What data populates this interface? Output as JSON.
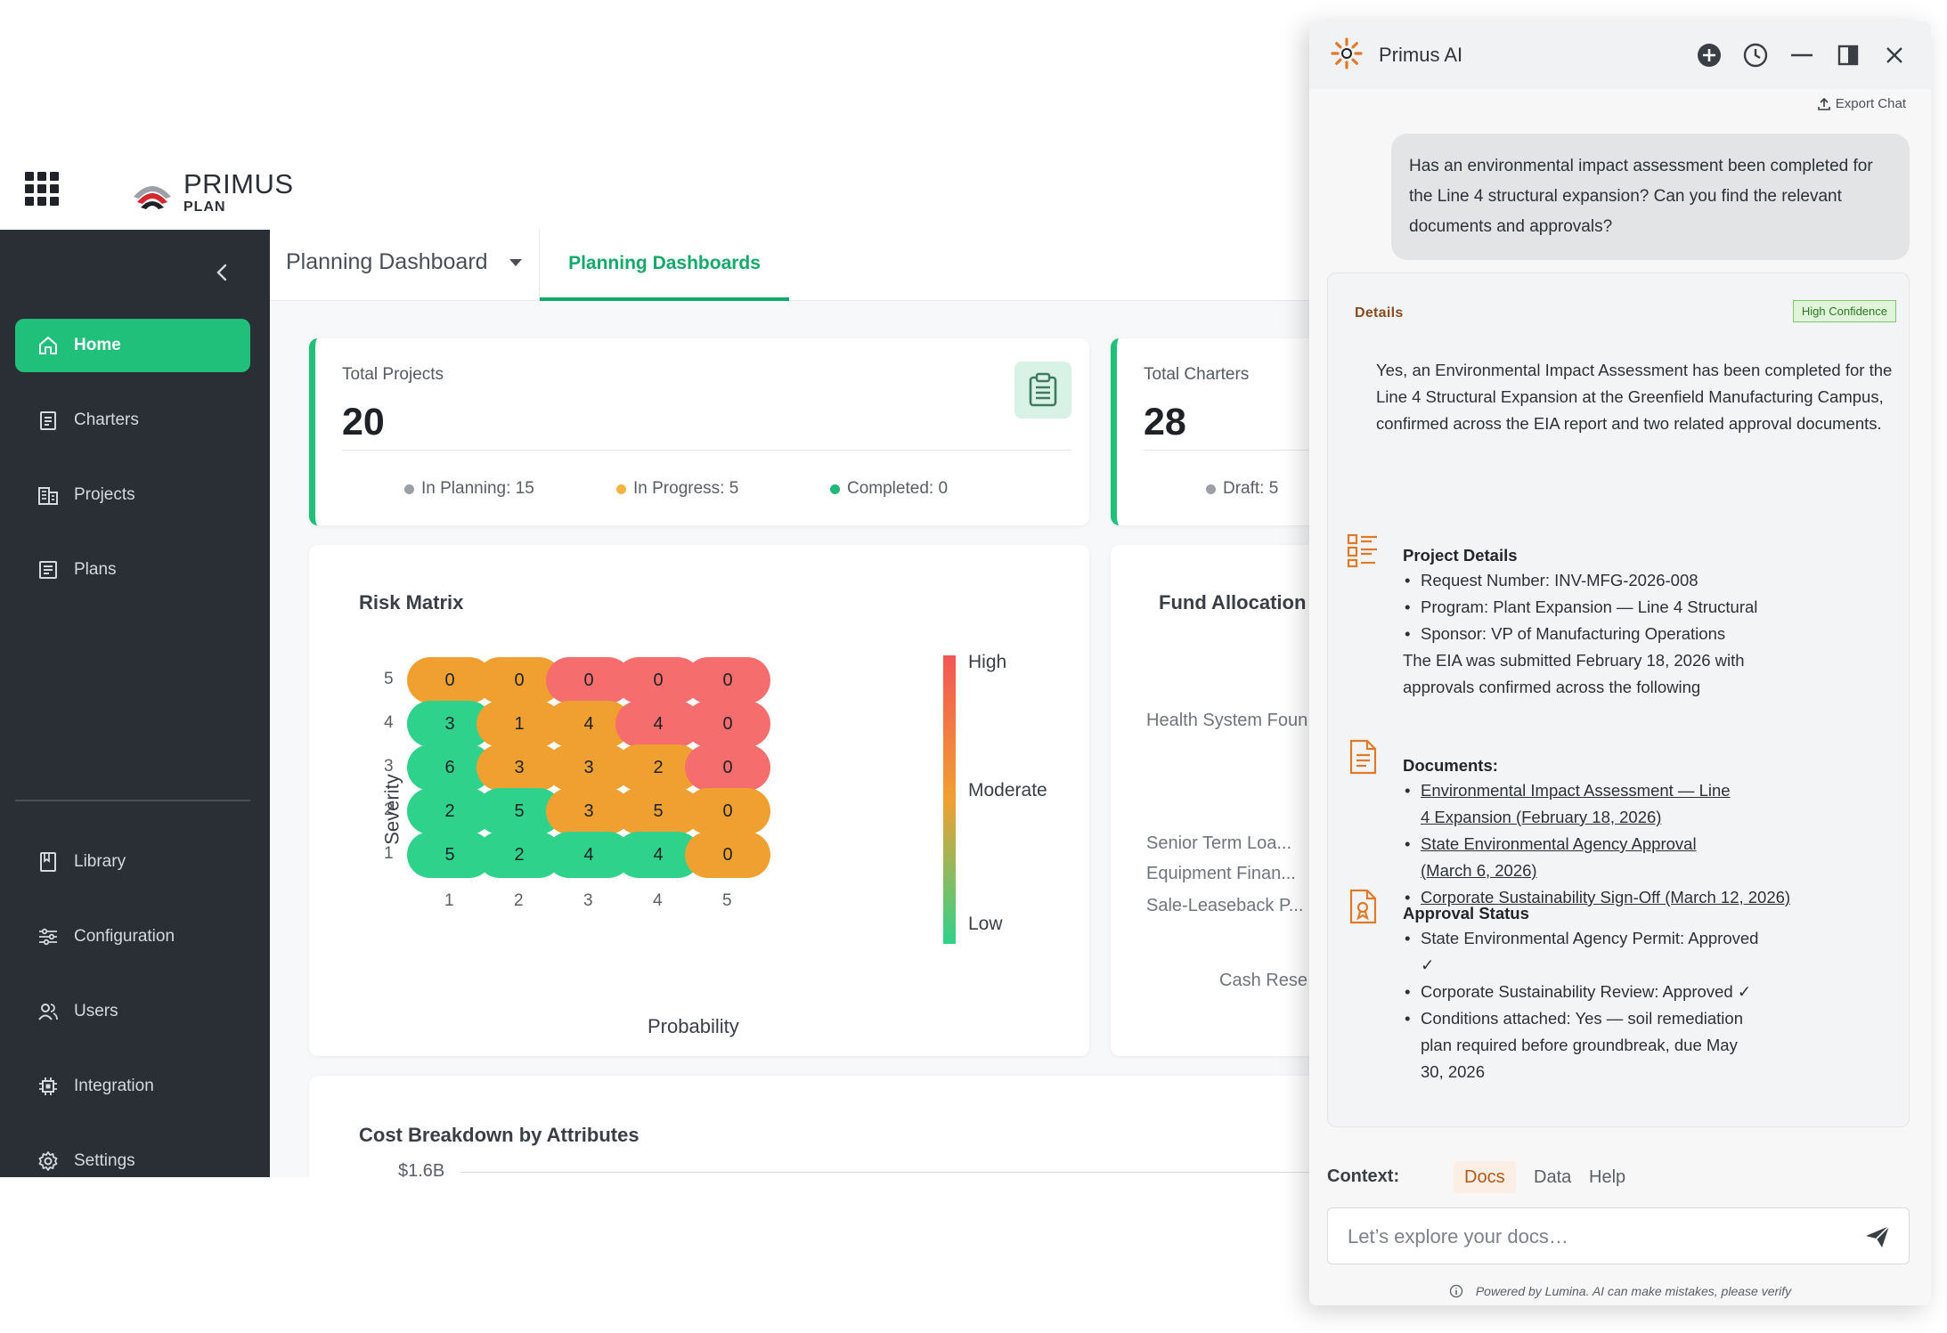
{
  "app": {
    "logo_main": "PRIMUS",
    "logo_sub": "PLAN"
  },
  "sidebar": {
    "items": [
      {
        "label": "Home",
        "icon": "home-icon"
      },
      {
        "label": "Charters",
        "icon": "document-icon"
      },
      {
        "label": "Projects",
        "icon": "building-icon"
      },
      {
        "label": "Plans",
        "icon": "list-icon"
      },
      {
        "label": "Library",
        "icon": "bookmark-icon"
      },
      {
        "label": "Configuration",
        "icon": "sliders-icon"
      },
      {
        "label": "Users",
        "icon": "users-icon"
      },
      {
        "label": "Integration",
        "icon": "chip-icon"
      },
      {
        "label": "Settings",
        "icon": "gear-icon"
      }
    ],
    "active": "Home"
  },
  "tabs": {
    "selector": "Planning Dashboard",
    "active_tab": "Planning Dashboards"
  },
  "stats": {
    "projects": {
      "label": "Total Projects",
      "value": "20",
      "legend": [
        {
          "label": "In Planning: 15",
          "color": "#9aa0a6"
        },
        {
          "label": "In Progress: 5",
          "color": "#f5b342"
        },
        {
          "label": "Completed: 0",
          "color": "#1fb77a"
        }
      ]
    },
    "charters": {
      "label": "Total Charters",
      "value": "28",
      "legend": [
        {
          "label": "Draft: 5",
          "color": "#9aa0a6"
        }
      ]
    }
  },
  "risk_matrix": {
    "title": "Risk Matrix",
    "y_title": "Severity",
    "x_title": "Probability",
    "scale_labels": [
      "High",
      "Moderate",
      "Low"
    ],
    "colors": {
      "green": "#2fd28a",
      "orange": "#efa030",
      "red": "#f66d6d"
    }
  },
  "chart_data": {
    "type": "heatmap",
    "title": "Risk Matrix",
    "xlabel": "Probability",
    "ylabel": "Severity",
    "x": [
      "1",
      "2",
      "3",
      "4",
      "5"
    ],
    "y": [
      "5",
      "4",
      "3",
      "2",
      "1"
    ],
    "values": [
      [
        0,
        0,
        0,
        0,
        0
      ],
      [
        3,
        1,
        4,
        4,
        0
      ],
      [
        6,
        3,
        3,
        2,
        0
      ],
      [
        2,
        5,
        3,
        5,
        0
      ],
      [
        5,
        2,
        4,
        4,
        0
      ]
    ],
    "levels": [
      [
        "orange",
        "orange",
        "red",
        "red",
        "red"
      ],
      [
        "green",
        "orange",
        "orange",
        "red",
        "red"
      ],
      [
        "green",
        "orange",
        "orange",
        "orange",
        "red"
      ],
      [
        "green",
        "green",
        "orange",
        "orange",
        "orange"
      ],
      [
        "green",
        "green",
        "green",
        "green",
        "orange"
      ]
    ],
    "legend": [
      "High",
      "Moderate",
      "Low"
    ]
  },
  "fund_allocation": {
    "title": "Fund Allocation",
    "labels": [
      "Health System Foun",
      "Senior Term Loa...",
      "Equipment Finan...",
      "Sale-Leaseback P...",
      "Cash Rese"
    ]
  },
  "cost_breakdown": {
    "title": "Cost Breakdown by Attributes",
    "axis_label": "$1.6B"
  },
  "ai": {
    "title": "Primus AI",
    "export_label": "Export Chat",
    "user_message": "Has an environmental impact assessment been completed for the Line 4 structural expansion? Can you find the relevant documents and approvals?",
    "details_label": "Details",
    "confidence": "High Confidence",
    "intro": "Yes, an Environmental Impact Assessment has been completed for the Line 4 Structural Expansion at the Greenfield Manufacturing Campus, confirmed across the EIA report and two related approval documents.",
    "project": {
      "title": "Project Details",
      "items": [
        "Request Number: INV-MFG-2026-008",
        "Program: Plant Expansion — Line 4 Structural",
        "Sponsor: VP of Manufacturing Operations"
      ],
      "note": "The EIA was submitted February 18, 2026 with approvals confirmed across the following"
    },
    "documents": {
      "title": "Documents:",
      "items": [
        "Environmental Impact Assessment — Line 4 Expansion (February 18, 2026)",
        "State Environmental Agency Approval (March 6, 2026)",
        "Corporate Sustainability Sign-Off (March 12, 2026)"
      ]
    },
    "approval": {
      "title": "Approval Status",
      "items": [
        "State Environmental Agency Permit: Approved ✓",
        "Corporate Sustainability Review: Approved ✓",
        "Conditions attached: Yes — soil remediation plan required before groundbreak, due May 30, 2026"
      ]
    },
    "context_label": "Context:",
    "context_tabs": [
      "Docs",
      "Data",
      "Help"
    ],
    "context_active": "Docs",
    "input_placeholder": "Let’s explore your docs…",
    "disclaimer": "Powered by Lumina. AI can make mistakes, please verify",
    "accent": "#e07a2a"
  }
}
